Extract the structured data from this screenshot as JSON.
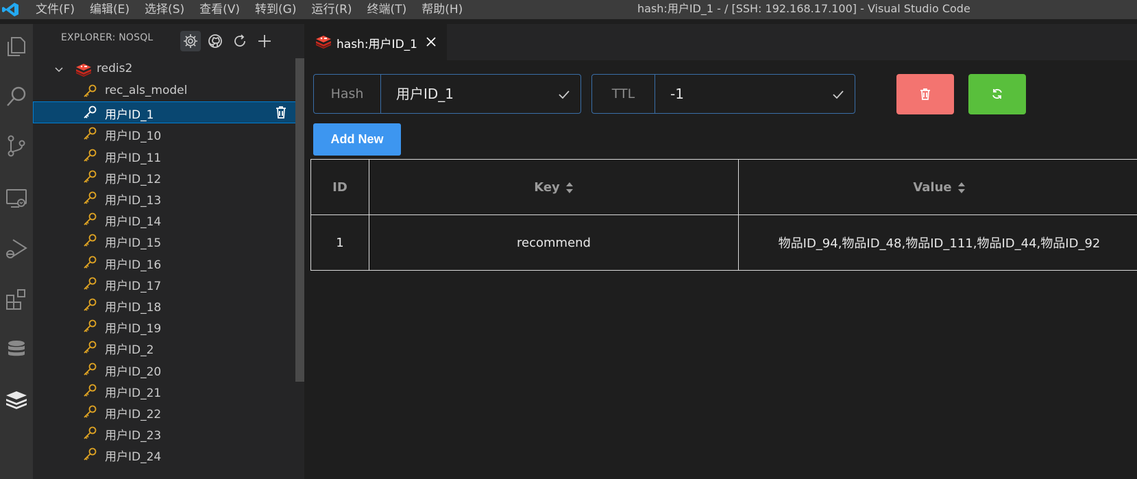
{
  "titlebar": {
    "menu": [
      "文件(F)",
      "编辑(E)",
      "选择(S)",
      "查看(V)",
      "转到(G)",
      "运行(R)",
      "终端(T)",
      "帮助(H)"
    ],
    "window_title": "hash:用户ID_1 - / [SSH: 192.168.17.100] - Visual Studio Code"
  },
  "activity_bar": [
    "explorer-icon",
    "search-icon",
    "source-control-icon",
    "remote-explorer-icon",
    "run-debug-icon",
    "extensions-icon",
    "database-icon",
    "redis-icon"
  ],
  "sidebar": {
    "title": "EXPLORER: NOSQL",
    "header_icons": [
      "gear-icon",
      "github-icon",
      "refresh-icon",
      "add-icon"
    ],
    "root": "redis2",
    "keys": [
      "rec_als_model",
      "用户ID_1",
      "用户ID_10",
      "用户ID_11",
      "用户ID_12",
      "用户ID_13",
      "用户ID_14",
      "用户ID_15",
      "用户ID_16",
      "用户ID_17",
      "用户ID_18",
      "用户ID_19",
      "用户ID_2",
      "用户ID_20",
      "用户ID_21",
      "用户ID_22",
      "用户ID_23",
      "用户ID_24"
    ],
    "selected_key": "用户ID_1"
  },
  "editor": {
    "tab_label": "hash:用户ID_1",
    "hash_prefix": "Hash",
    "hash_value": "用户ID_1",
    "ttl_prefix": "TTL",
    "ttl_value": "-1",
    "add_button": "Add New",
    "table": {
      "headers": [
        "ID",
        "Key",
        "Value"
      ],
      "rows": [
        {
          "id": "1",
          "key": "recommend",
          "value": "物品ID_94,物品ID_48,物品ID_111,物品ID_44,物品ID_92"
        }
      ]
    }
  },
  "colors": {
    "titlebar": "#3c3c3c",
    "activity_bar": "#333333",
    "sidebar": "#252526",
    "editor": "#1e1e1e",
    "selection": "#094771",
    "delete_button": "#f37470",
    "refresh_button": "#59bf3c",
    "add_button": "#3d96f0",
    "key_icon": "#e0a423",
    "redis_red": "#d82c20"
  }
}
